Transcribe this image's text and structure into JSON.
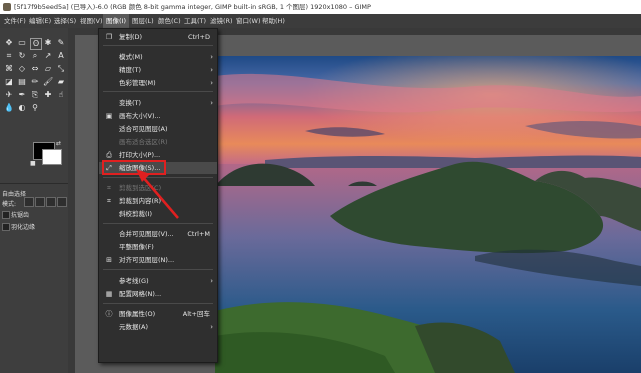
{
  "window": {
    "title": "[5f17f9b5eed5a] (已导入)-6.0 (RGB 颜色 8-bit gamma integer, GIMP built-in sRGB, 1 个图层) 1920x1080 – GIMP"
  },
  "menubar": {
    "items": [
      "文件(F)",
      "编辑(E)",
      "选择(S)",
      "视图(V)",
      "图像(I)",
      "图层(L)",
      "颜色(C)",
      "工具(T)",
      "滤镜(R)",
      "窗口(W)",
      "帮助(H)"
    ],
    "active_index": 4
  },
  "toolbox": {
    "options_title": "自由选择",
    "mode_label": "模式:",
    "checkboxes": [
      "抗锯齿",
      "羽化边缘"
    ]
  },
  "image_menu": {
    "items": [
      {
        "label": "复制(D)",
        "shortcut": "Ctrl+D",
        "icon": "duplicate-icon",
        "glyph": "❐"
      },
      {
        "label": "模式(M)",
        "submenu": true
      },
      {
        "label": "精度(T)",
        "submenu": true
      },
      {
        "label": "色彩管理(M)",
        "submenu": true
      },
      {
        "label": "变换(T)",
        "submenu": true
      },
      {
        "label": "画布大小(V)...",
        "icon": "canvas-size-icon",
        "glyph": "▣"
      },
      {
        "label": "适合可见图层(A)",
        "icon": "",
        "glyph": ""
      },
      {
        "label": "画布适合选区(R)",
        "disabled": true,
        "icon": "",
        "glyph": ""
      },
      {
        "label": "打印大小(P)...",
        "icon": "print-size-icon",
        "glyph": "⎙"
      },
      {
        "label": "缩放图像(S)...",
        "icon": "scale-image-icon",
        "glyph": "⤢",
        "highlighted": true
      },
      {
        "label": "剪裁到选区(C)",
        "disabled": true,
        "icon": "crop-icon",
        "glyph": "⌗"
      },
      {
        "label": "剪裁到内容(R)",
        "icon": "crop-content-icon",
        "glyph": "⌗"
      },
      {
        "label": "斜校剪裁(I)",
        "icon": "",
        "glyph": ""
      },
      {
        "label": "合并可见图层(V)...",
        "shortcut": "Ctrl+M",
        "icon": "",
        "glyph": ""
      },
      {
        "label": "平整图像(F)",
        "icon": "",
        "glyph": ""
      },
      {
        "label": "对齐可见图层(N)...",
        "icon": "align-icon",
        "glyph": "⊞"
      },
      {
        "label": "参考线(G)",
        "submenu": true
      },
      {
        "label": "配置网格(N)...",
        "icon": "grid-icon",
        "glyph": "▦"
      },
      {
        "label": "图像属性(O)",
        "shortcut": "Alt+回车",
        "icon": "info-icon",
        "glyph": "ⓘ"
      },
      {
        "label": "元数据(A)",
        "submenu": true
      }
    ]
  },
  "colors": {
    "accent_red": "#e02020",
    "menu_bg": "#2f2f2f",
    "toolbox_bg": "#3e3e3e"
  }
}
